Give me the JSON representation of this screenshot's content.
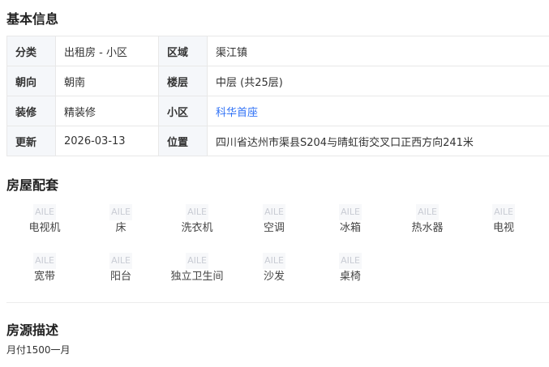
{
  "basic_info": {
    "title": "基本信息",
    "rows": [
      [
        {
          "k": "分类",
          "v": "出租房 - 小区"
        },
        {
          "k": "区域",
          "v": "渠江镇"
        }
      ],
      [
        {
          "k": "朝向",
          "v": "朝南"
        },
        {
          "k": "楼层",
          "v": "中层 (共25层)"
        }
      ],
      [
        {
          "k": "装修",
          "v": "精装修"
        },
        {
          "k": "小区",
          "v": "科华首座"
        }
      ],
      [
        {
          "k": "更新",
          "v": "2026-03-13"
        },
        {
          "k": "位置",
          "v": "四川省达州市渠县S204与晴虹街交叉口正西方向241米"
        }
      ]
    ]
  },
  "amenities": {
    "title": "房屋配套",
    "icon_text": "AILE",
    "items": [
      "电视机",
      "床",
      "洗衣机",
      "空调",
      "冰箱",
      "热水器",
      "电视",
      "宽带",
      "阳台",
      "独立卫生间",
      "沙发",
      "桌椅"
    ]
  },
  "description": {
    "title": "房源描述",
    "text": "月付1500一月"
  },
  "colors": {
    "link": "#3072f6",
    "key_bg": "#f5f7fa",
    "border": "#e8e8e8"
  }
}
